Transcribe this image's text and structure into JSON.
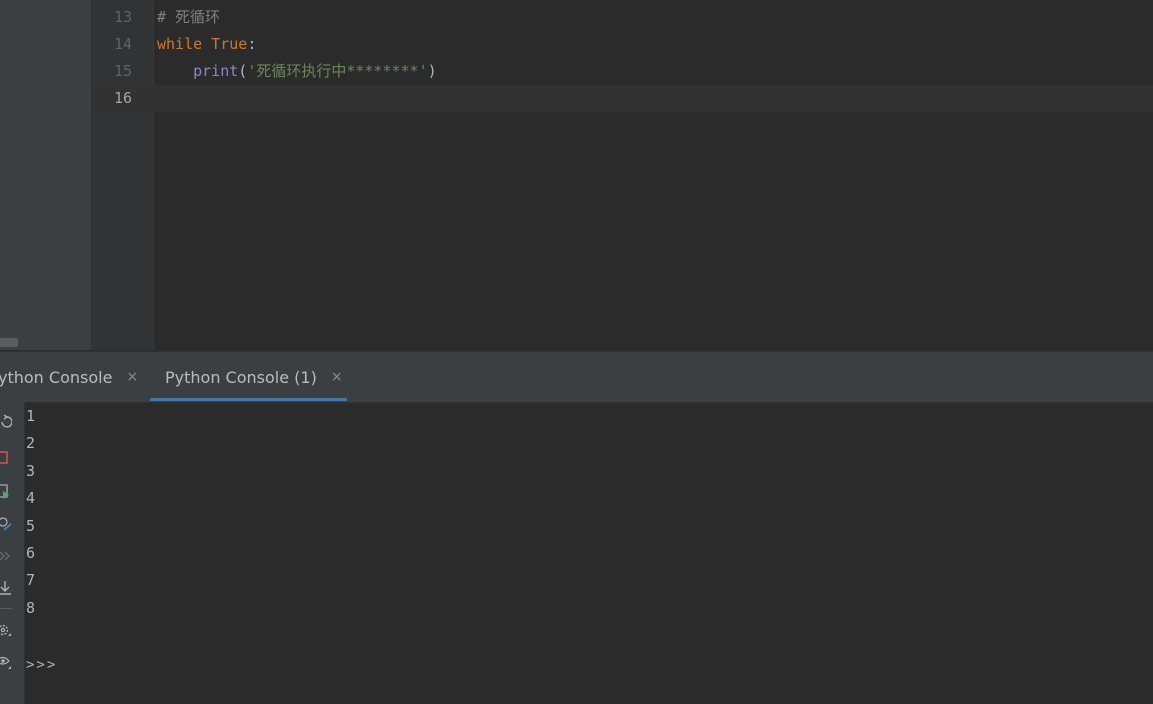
{
  "editor": {
    "lines": [
      {
        "number": "13",
        "comment": "# 死循环"
      },
      {
        "number": "14",
        "keyword": "while",
        "constant": "True",
        "colon": ":"
      },
      {
        "number": "15",
        "indent": "    ",
        "builtin": "print",
        "open": "(",
        "string": "'死循环执行中********'",
        "close": ")"
      },
      {
        "number": "16"
      }
    ]
  },
  "tool_window": {
    "tabs": [
      {
        "label": "ython Console",
        "close": "×"
      },
      {
        "label": "Python Console (1)",
        "close": "×"
      }
    ]
  },
  "console": {
    "output": [
      "1",
      "2",
      "3",
      "4",
      "5",
      "6",
      "7",
      "8"
    ],
    "prompt": ">>>"
  },
  "colors": {
    "keyword": "#cc7832",
    "string": "#6a8759",
    "builtin": "#8888c6",
    "comment": "#808080",
    "tab_underline": "#4a88c7",
    "stop": "#c75450",
    "run": "#59a869"
  }
}
